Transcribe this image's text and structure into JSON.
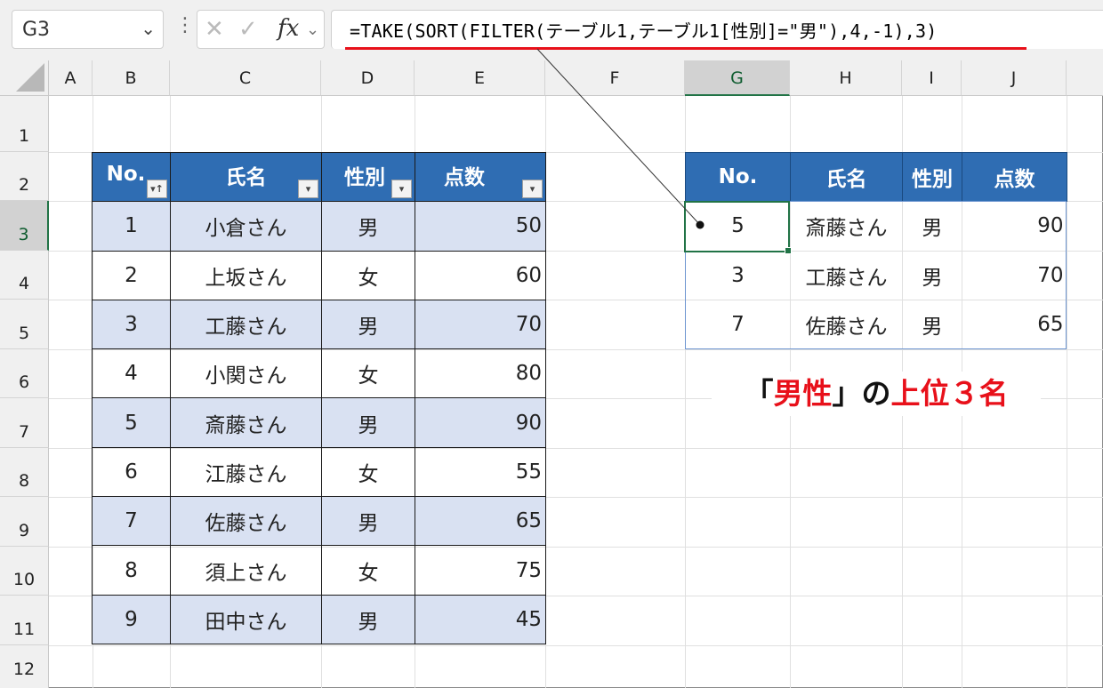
{
  "formula_bar": {
    "name_box": "G3",
    "formula": "=TAKE(SORT(FILTER(テーブル1,テーブル1[性別]=\"男\"),4,-1),3)",
    "cancel_glyph": "✕",
    "enter_glyph": "✓",
    "fx_label": "fx"
  },
  "columns": [
    "A",
    "B",
    "C",
    "D",
    "E",
    "F",
    "G",
    "H",
    "I",
    "J"
  ],
  "rows": [
    "1",
    "2",
    "3",
    "4",
    "5",
    "6",
    "7",
    "8",
    "9",
    "10",
    "11",
    "12"
  ],
  "source_table": {
    "headers": [
      "No.",
      "氏名",
      "性別",
      "点数"
    ],
    "rows": [
      [
        "1",
        "小倉さん",
        "男",
        "50"
      ],
      [
        "2",
        "上坂さん",
        "女",
        "60"
      ],
      [
        "3",
        "工藤さん",
        "男",
        "70"
      ],
      [
        "4",
        "小関さん",
        "女",
        "80"
      ],
      [
        "5",
        "斎藤さん",
        "男",
        "90"
      ],
      [
        "6",
        "江藤さん",
        "女",
        "55"
      ],
      [
        "7",
        "佐藤さん",
        "男",
        "65"
      ],
      [
        "8",
        "須上さん",
        "女",
        "75"
      ],
      [
        "9",
        "田中さん",
        "男",
        "45"
      ]
    ]
  },
  "result_table": {
    "headers": [
      "No.",
      "氏名",
      "性別",
      "点数"
    ],
    "rows": [
      [
        "5",
        "斎藤さん",
        "男",
        "90"
      ],
      [
        "3",
        "工藤さん",
        "男",
        "70"
      ],
      [
        "7",
        "佐藤さん",
        "男",
        "65"
      ]
    ]
  },
  "callout": {
    "open_bracket": "「",
    "part1": "男性",
    "close_bracket": "」の",
    "part2": "上位３名"
  },
  "colors": {
    "header_blue": "#2f6db3",
    "band": "#d9e1f2",
    "excel_green": "#217346",
    "accent_red": "#e8101a"
  }
}
